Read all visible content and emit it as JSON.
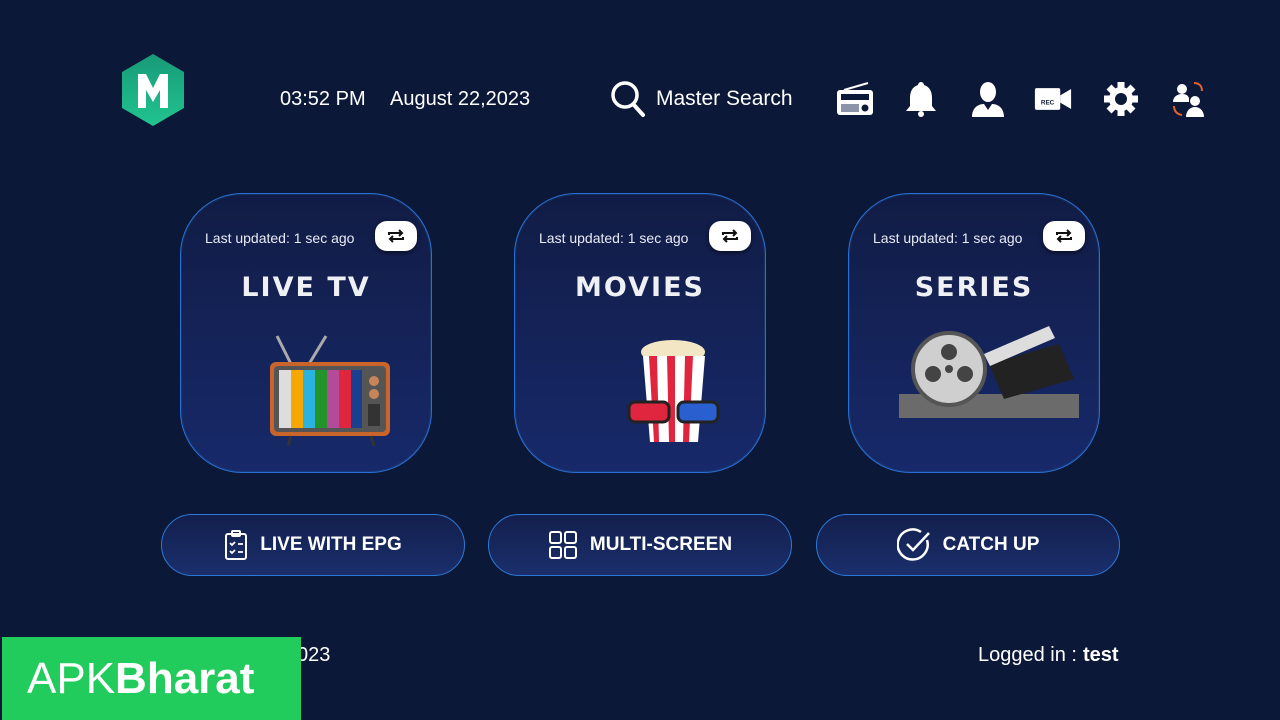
{
  "header": {
    "time": "03:52 PM",
    "date": "August 22,2023",
    "search_label": "Master Search",
    "icons": [
      "radio-icon",
      "bell-icon",
      "user-icon",
      "record-icon",
      "gear-icon",
      "switch-user-icon"
    ]
  },
  "cards": [
    {
      "title": "LIVE TV",
      "updated": "Last updated: 1 sec ago"
    },
    {
      "title": "MOVIES",
      "updated": "Last updated: 1 sec ago"
    },
    {
      "title": "SERIES",
      "updated": "Last updated: 1 sec ago"
    }
  ],
  "buttons": [
    {
      "label": "LIVE WITH EPG"
    },
    {
      "label": "MULTI-SCREEN"
    },
    {
      "label": "CATCH UP"
    }
  ],
  "footer": {
    "date_partial": "023",
    "logged_in_label": "Logged in :",
    "username": "test"
  },
  "watermark": {
    "text_light": "APK",
    "text_bold": "Bharat"
  },
  "colors": {
    "background": "#0c1838",
    "logo": "#1db088",
    "watermark": "#22cc5c",
    "card_border": "#2b6fd6"
  }
}
